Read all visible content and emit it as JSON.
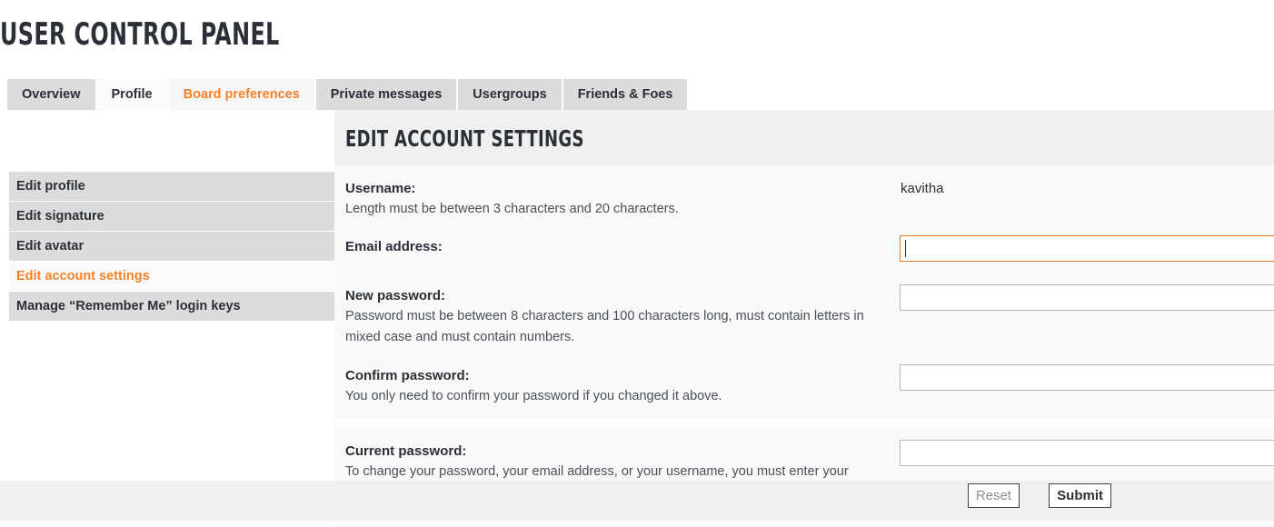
{
  "page": {
    "title": "USER CONTROL PANEL"
  },
  "tabs": [
    {
      "label": "Overview",
      "state": "normal"
    },
    {
      "label": "Profile",
      "state": "active-light"
    },
    {
      "label": "Board preferences",
      "state": "active-orange"
    },
    {
      "label": "Private messages",
      "state": "normal"
    },
    {
      "label": "Usergroups",
      "state": "normal"
    },
    {
      "label": "Friends & Foes",
      "state": "normal"
    }
  ],
  "sidebar": {
    "items": [
      {
        "label": "Edit profile",
        "active": false
      },
      {
        "label": "Edit signature",
        "active": false
      },
      {
        "label": "Edit avatar",
        "active": false
      },
      {
        "label": "Edit account settings",
        "active": true
      },
      {
        "label": "Manage “Remember Me” login keys",
        "active": false
      }
    ]
  },
  "panel": {
    "heading": "EDIT ACCOUNT SETTINGS"
  },
  "form": {
    "username": {
      "label": "Username:",
      "hint": "Length must be between 3 characters and 20 characters.",
      "value": "kavitha"
    },
    "email": {
      "label": "Email address:",
      "value": "",
      "placeholder": "",
      "focused": true
    },
    "new_password": {
      "label": "New password:",
      "hint": "Password must be between 8 characters and 100 characters long, must contain letters in mixed case and must contain numbers.",
      "value": "",
      "placeholder": ""
    },
    "confirm_password": {
      "label": "Confirm password:",
      "hint": "You only need to confirm your password if you changed it above.",
      "value": "",
      "placeholder": ""
    },
    "current_password": {
      "label": "Current password:",
      "hint": "To change your password, your email address, or your username, you must enter your current password.",
      "value": "",
      "placeholder": ""
    }
  },
  "buttons": {
    "reset": "Reset",
    "submit": "Submit"
  },
  "colors": {
    "accent": "#f3802b",
    "focus_border": "#e07b23",
    "tab_bg": "#dcdcdc",
    "panel_bg": "#f0f0f0",
    "fieldset_bg": "#f9f9f9",
    "text": "#2b2f38"
  }
}
